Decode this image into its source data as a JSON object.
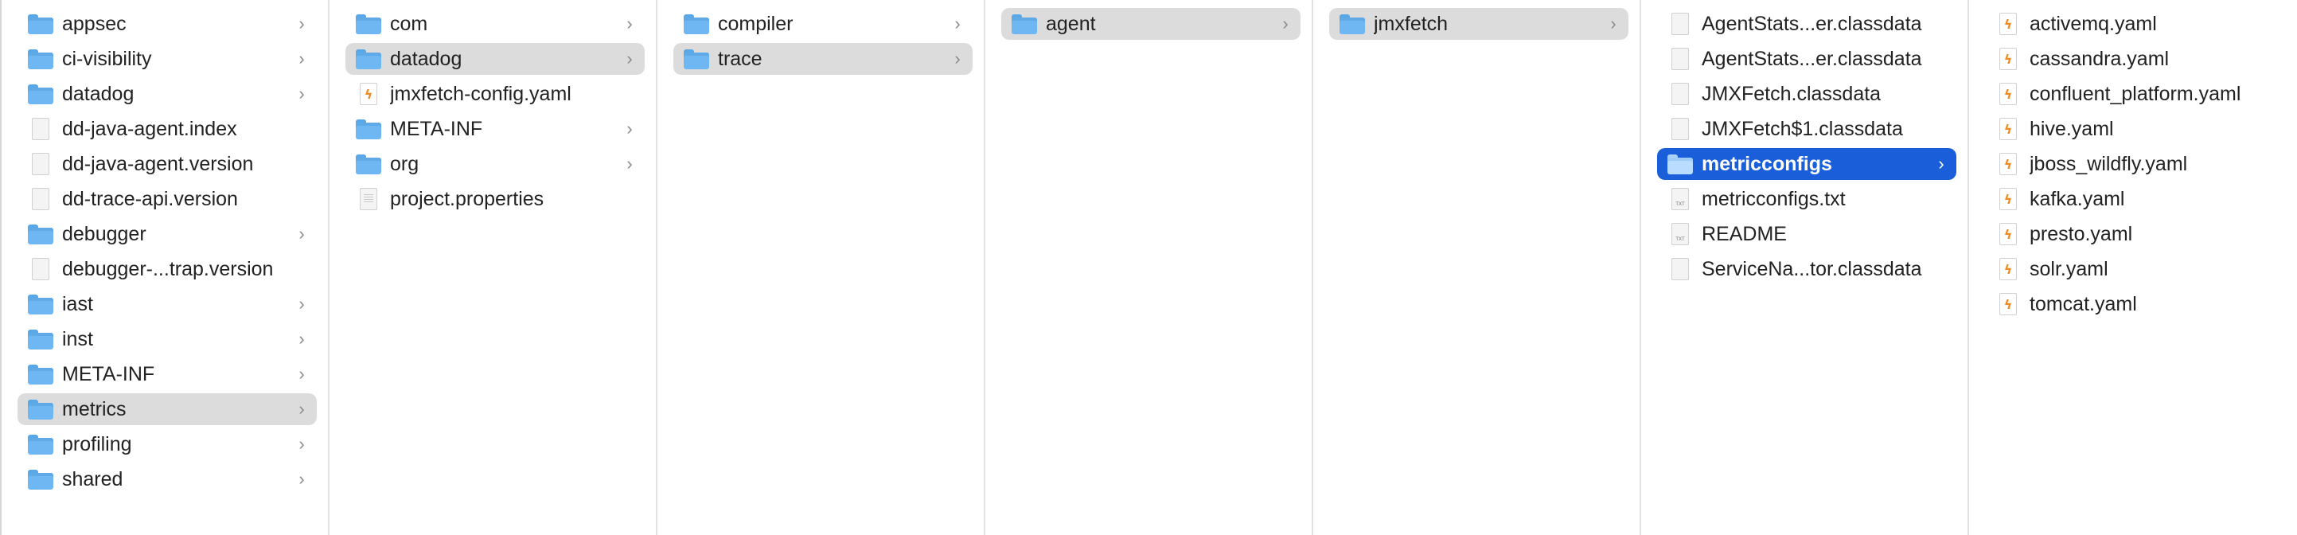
{
  "columns": [
    {
      "items": [
        {
          "label": "appsec",
          "kind": "folder",
          "chevron": true
        },
        {
          "label": "ci-visibility",
          "kind": "folder",
          "chevron": true
        },
        {
          "label": "datadog",
          "kind": "folder",
          "chevron": true
        },
        {
          "label": "dd-java-agent.index",
          "kind": "doc"
        },
        {
          "label": "dd-java-agent.version",
          "kind": "doc"
        },
        {
          "label": "dd-trace-api.version",
          "kind": "doc"
        },
        {
          "label": "debugger",
          "kind": "folder",
          "chevron": true
        },
        {
          "label": "debugger-...trap.version",
          "kind": "doc"
        },
        {
          "label": "iast",
          "kind": "folder",
          "chevron": true
        },
        {
          "label": "inst",
          "kind": "folder",
          "chevron": true
        },
        {
          "label": "META-INF",
          "kind": "folder",
          "chevron": true
        },
        {
          "label": "metrics",
          "kind": "folder",
          "chevron": true,
          "selected": "gray"
        },
        {
          "label": "profiling",
          "kind": "folder",
          "chevron": true
        },
        {
          "label": "shared",
          "kind": "folder",
          "chevron": true
        }
      ]
    },
    {
      "items": [
        {
          "label": "com",
          "kind": "folder",
          "chevron": true
        },
        {
          "label": "datadog",
          "kind": "folder",
          "chevron": true,
          "selected": "gray"
        },
        {
          "label": "jmxfetch-config.yaml",
          "kind": "yaml"
        },
        {
          "label": "META-INF",
          "kind": "folder",
          "chevron": true
        },
        {
          "label": "org",
          "kind": "folder",
          "chevron": true
        },
        {
          "label": "project.properties",
          "kind": "doc-lines"
        }
      ]
    },
    {
      "items": [
        {
          "label": "compiler",
          "kind": "folder",
          "chevron": true
        },
        {
          "label": "trace",
          "kind": "folder",
          "chevron": true,
          "selected": "gray"
        }
      ]
    },
    {
      "items": [
        {
          "label": "agent",
          "kind": "folder",
          "chevron": true,
          "selected": "gray"
        }
      ]
    },
    {
      "items": [
        {
          "label": "jmxfetch",
          "kind": "folder",
          "chevron": true,
          "selected": "gray"
        }
      ]
    },
    {
      "items": [
        {
          "label": "AgentStats...er.classdata",
          "kind": "doc"
        },
        {
          "label": "AgentStats...er.classdata",
          "kind": "doc"
        },
        {
          "label": "JMXFetch.classdata",
          "kind": "doc"
        },
        {
          "label": "JMXFetch$1.classdata",
          "kind": "doc"
        },
        {
          "label": "metricconfigs",
          "kind": "folder",
          "chevron": true,
          "selected": "blue"
        },
        {
          "label": "metricconfigs.txt",
          "kind": "txt"
        },
        {
          "label": "README",
          "kind": "txt"
        },
        {
          "label": "ServiceNa...tor.classdata",
          "kind": "doc"
        }
      ]
    },
    {
      "items": [
        {
          "label": "activemq.yaml",
          "kind": "yaml"
        },
        {
          "label": "cassandra.yaml",
          "kind": "yaml"
        },
        {
          "label": "confluent_platform.yaml",
          "kind": "yaml"
        },
        {
          "label": "hive.yaml",
          "kind": "yaml"
        },
        {
          "label": "jboss_wildfly.yaml",
          "kind": "yaml"
        },
        {
          "label": "kafka.yaml",
          "kind": "yaml"
        },
        {
          "label": "presto.yaml",
          "kind": "yaml"
        },
        {
          "label": "solr.yaml",
          "kind": "yaml"
        },
        {
          "label": "tomcat.yaml",
          "kind": "yaml"
        }
      ]
    }
  ],
  "colors": {
    "selection_gray": "#dcdcdc",
    "selection_blue": "#1a5fd9",
    "folder": "#6fb7f2",
    "yaml_accent": "#f08a1c"
  },
  "icons": {
    "folder": "folder-icon",
    "doc": "document-icon",
    "doc-lines": "text-document-icon",
    "txt": "txt-file-icon",
    "yaml": "yaml-file-icon",
    "chevron": "chevron-right-icon"
  },
  "chevron_glyph": "›"
}
